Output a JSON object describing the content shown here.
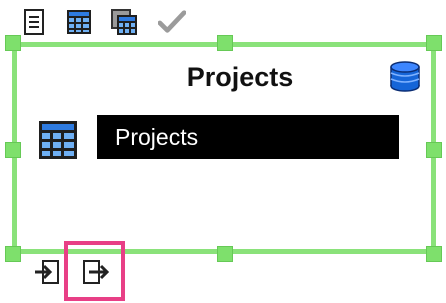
{
  "toolbar": {
    "items": [
      {
        "icon": "document-icon"
      },
      {
        "icon": "table-grid-icon"
      },
      {
        "icon": "table-stack-icon"
      },
      {
        "icon": "checkmark-icon"
      }
    ]
  },
  "node": {
    "title": "Projects",
    "label": "Projects",
    "icon": "database-icon",
    "row_icon": "table-grid-icon"
  },
  "bottom_actions": [
    {
      "icon": "import-arrow-icon"
    },
    {
      "icon": "export-arrow-icon",
      "highlighted": true
    }
  ],
  "colors": {
    "selection_frame": "#8ae27a",
    "highlight": "#e83f86",
    "label_bg": "#000000",
    "db_icon": "#1565d8"
  }
}
